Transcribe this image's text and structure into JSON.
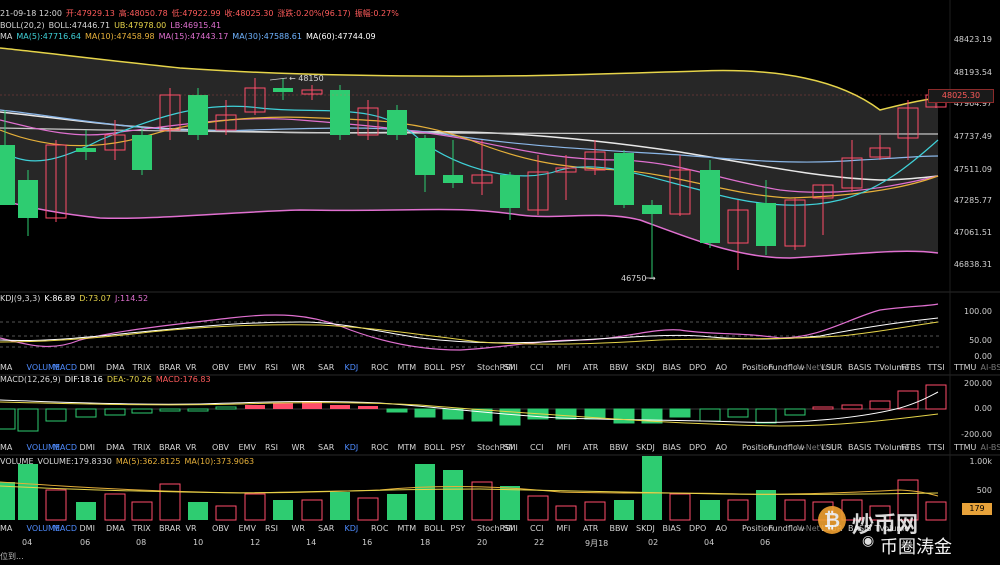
{
  "header": {
    "row1": [
      {
        "text": "21-09-18 12:00",
        "color": "#d8d8d8"
      },
      {
        "text": "开:47929.13",
        "color": "#ff5b5b"
      },
      {
        "text": "高:48050.78",
        "color": "#ff5b5b"
      },
      {
        "text": "低:47922.99",
        "color": "#ff5b5b"
      },
      {
        "text": "收:48025.30",
        "color": "#ff5b5b"
      },
      {
        "text": "涨跌:0.20%(96.17)",
        "color": "#ff5b5b"
      },
      {
        "text": "振幅:0.27%",
        "color": "#ff5b5b"
      }
    ],
    "row2": [
      {
        "text": "BOLL(20,2)",
        "color": "#d8d8d8"
      },
      {
        "text": "BOLL:47446.71",
        "color": "#d8d8d8"
      },
      {
        "text": "UB:47978.00",
        "color": "#e6d44a"
      },
      {
        "text": "LB:46915.41",
        "color": "#e070d0"
      }
    ],
    "row3": [
      {
        "text": "MA",
        "color": "#d8d8d8"
      },
      {
        "text": "MA(5):47716.64",
        "color": "#3fd1d8"
      },
      {
        "text": "MA(10):47458.98",
        "color": "#e6b03a"
      },
      {
        "text": "MA(15):47443.17",
        "color": "#e070d0"
      },
      {
        "text": "MA(30):47588.61",
        "color": "#6fb3ff"
      },
      {
        "text": "MA(60):47744.09",
        "color": "#ffffff"
      }
    ]
  },
  "price_axis": [
    "48423.19",
    "48193.54",
    "47964.97",
    "47737.49",
    "47511.09",
    "47285.77",
    "47061.51",
    "46838.31"
  ],
  "current_price": "48025.30",
  "annotations": {
    "high": "48150",
    "low": "46750"
  },
  "kdj": {
    "legend": [
      {
        "text": "KDJ(9,3,3)",
        "color": "#d8d8d8"
      },
      {
        "text": "K:86.89",
        "color": "#ffffff"
      },
      {
        "text": "D:73.07",
        "color": "#e6d44a"
      },
      {
        "text": "J:114.52",
        "color": "#e070d0"
      }
    ],
    "axis": [
      "100.00",
      "50.00",
      "0.00"
    ]
  },
  "macd": {
    "legend": [
      {
        "text": "MACD(12,26,9)",
        "color": "#d8d8d8"
      },
      {
        "text": "DIF:18.16",
        "color": "#ffffff"
      },
      {
        "text": "DEA:-70.26",
        "color": "#e6d44a"
      },
      {
        "text": "MACD:176.83",
        "color": "#ff5b5b"
      }
    ],
    "axis": [
      "200.00",
      "0.00",
      "-200.00"
    ]
  },
  "volume": {
    "legend": [
      {
        "text": "VOLUME",
        "color": "#d8d8d8"
      },
      {
        "text": "VOLUME:179.8330",
        "color": "#d8d8d8"
      },
      {
        "text": "MA(5):362.8125",
        "color": "#e6b03a"
      },
      {
        "text": "MA(10):373.9063",
        "color": "#e6b03a"
      }
    ],
    "axis": [
      "1.00k",
      "500"
    ],
    "current": "179"
  },
  "indicator_tabs_1": [
    "MA",
    "VOLUME",
    "MACD",
    "DMI",
    "DMA",
    "TRIX",
    "BRAR",
    "VR",
    "OBV",
    "EMV",
    "RSI",
    "WR",
    "SAR",
    "KDJ",
    "ROC",
    "MTM",
    "BOLL",
    "PSY",
    "StochRSI",
    "SMI",
    "CCI",
    "MFI",
    "ATR",
    "BBW",
    "SKDJ",
    "BIAS",
    "DPO",
    "AO",
    "Position",
    "Fundflow",
    "AI-NetVOL",
    "LSUR",
    "BASIS",
    "TVolume",
    "FTBS",
    "TTSI",
    "TTMU",
    "AI-BSI"
  ],
  "indicator_tabs_2": [
    "MA",
    "VOLUME",
    "MACD",
    "DMI",
    "DMA",
    "TRIX",
    "BRAR",
    "VR",
    "OBV",
    "EMV",
    "RSI",
    "WR",
    "SAR",
    "KDJ",
    "ROC",
    "MTM",
    "BOLL",
    "PSY",
    "StochRSI",
    "SMI",
    "CCI",
    "MFI",
    "ATR",
    "BBW",
    "SKDJ",
    "BIAS",
    "DPO",
    "AO",
    "Position",
    "Fundflow",
    "AI-NetVOL",
    "LSUR",
    "BASIS",
    "TVolume",
    "FTBS",
    "TTSI",
    "TTMU",
    "AI-BSI"
  ],
  "indicator_tabs_3": [
    "MA",
    "VOLUME",
    "MACD",
    "DMI",
    "DMA",
    "TRIX",
    "BRAR",
    "VR",
    "OBV",
    "EMV",
    "RSI",
    "WR",
    "SAR",
    "KDJ",
    "ROC",
    "MTM",
    "BOLL",
    "PSY",
    "StochRSI",
    "SMI",
    "CCI",
    "MFI",
    "ATR",
    "BBW",
    "SKDJ",
    "BIAS",
    "DPO",
    "AO",
    "Position",
    "Fundflow",
    "AI-NetVOL",
    "LSUR",
    "BASIS",
    "TVolume"
  ],
  "dates": [
    "04",
    "06",
    "08",
    "10",
    "12",
    "14",
    "16",
    "18",
    "20",
    "22",
    "9月18",
    "02",
    "04",
    "06"
  ],
  "footer": {
    "text": "位到..."
  },
  "watermark": {
    "brand": "炒币网",
    "account": "币圈涛金"
  },
  "colors": {
    "up": "#2ecc71",
    "down": "#ff4d6a",
    "bg": "#000000",
    "band": "#2a2a2a"
  }
}
